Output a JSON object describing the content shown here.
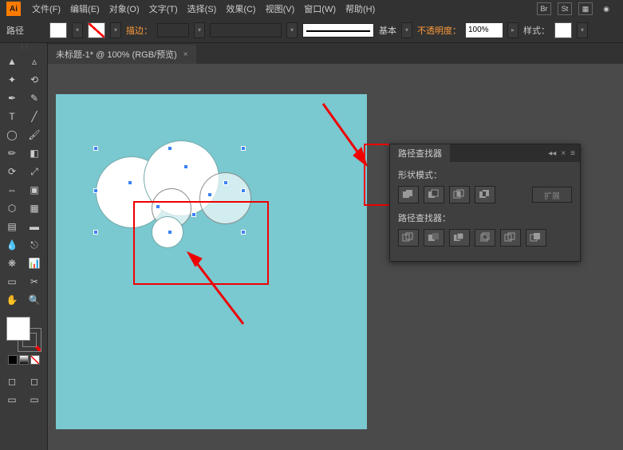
{
  "menubar": {
    "items": [
      "文件(F)",
      "编辑(E)",
      "对象(O)",
      "文字(T)",
      "选择(S)",
      "效果(C)",
      "视图(V)",
      "窗口(W)",
      "帮助(H)"
    ]
  },
  "controlbar": {
    "type_label": "路径",
    "stroke_label": "描边：",
    "profile_label": "基本",
    "opacity_label": "不透明度：",
    "opacity_value": "100%",
    "style_label": "样式："
  },
  "doctab": {
    "title": "未标题-1* @ 100% (RGB/预览)",
    "close": "×"
  },
  "panel": {
    "tab": "路径查找器",
    "shape_mode_label": "形状模式：",
    "expand_label": "扩展",
    "pathfinder_label": "路径查找器："
  },
  "icons": {
    "br": "Br",
    "st": "St"
  }
}
